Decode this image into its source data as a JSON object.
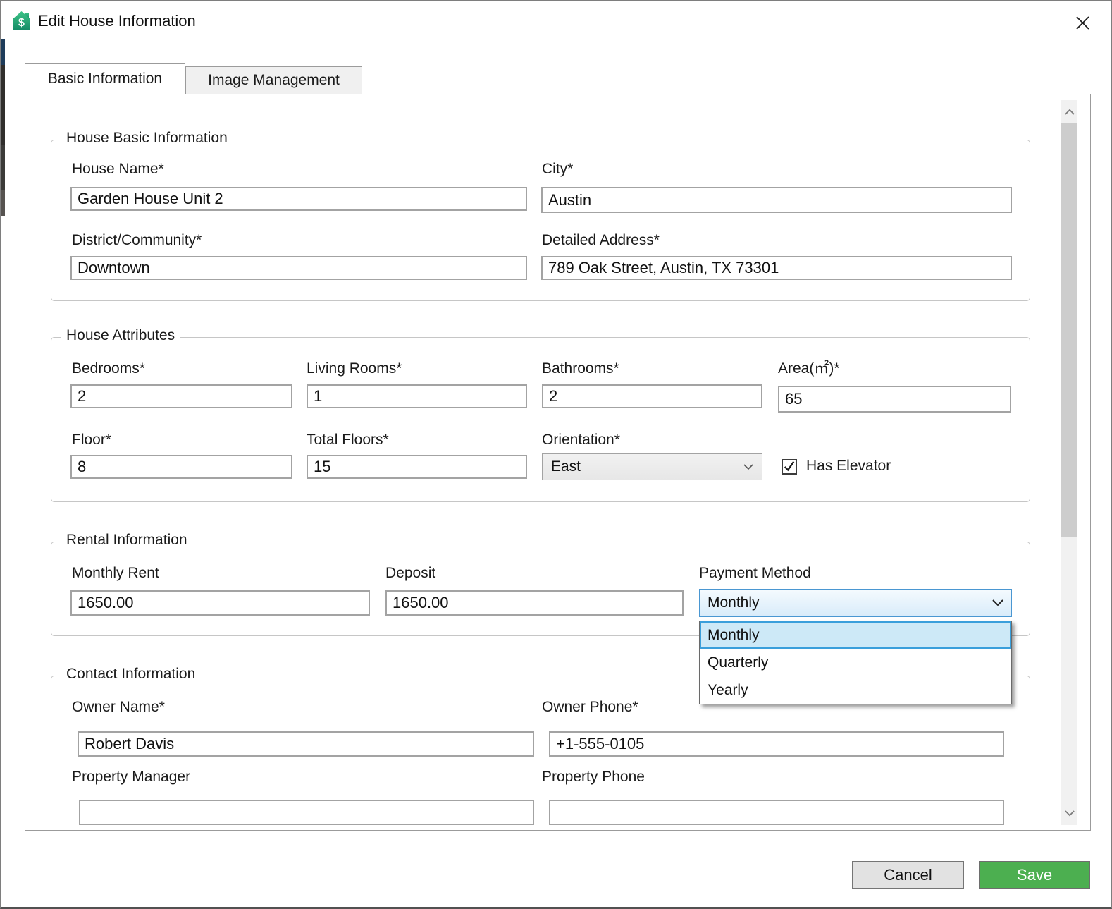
{
  "window": {
    "title": "Edit House Information"
  },
  "tabs": {
    "basic": "Basic Information",
    "image": "Image Management"
  },
  "basic": {
    "legend": "House Basic Information",
    "house_name_label": "House Name*",
    "house_name_value": "Garden House Unit 2",
    "city_label": "City*",
    "city_value": "Austin",
    "district_label": "District/Community*",
    "district_value": "Downtown",
    "address_label": "Detailed Address*",
    "address_value": "789 Oak Street, Austin, TX 73301"
  },
  "attributes": {
    "legend": "House Attributes",
    "bedrooms_label": "Bedrooms*",
    "bedrooms_value": "2",
    "living_rooms_label": "Living Rooms*",
    "living_rooms_value": "1",
    "bathrooms_label": "Bathrooms*",
    "bathrooms_value": "2",
    "area_label": "Area(㎡)*",
    "area_value": "65",
    "floor_label": "Floor*",
    "floor_value": "8",
    "total_floors_label": "Total Floors*",
    "total_floors_value": "15",
    "orientation_label": "Orientation*",
    "orientation_value": "East",
    "has_elevator_label": "Has Elevator",
    "has_elevator_checked": true
  },
  "rental": {
    "legend": "Rental Information",
    "monthly_rent_label": "Monthly Rent",
    "monthly_rent_value": "1650.00",
    "deposit_label": "Deposit",
    "deposit_value": "1650.00",
    "payment_label": "Payment Method",
    "payment_value": "Monthly",
    "payment_options": [
      "Monthly",
      "Quarterly",
      "Yearly"
    ],
    "payment_selected": "Monthly"
  },
  "contact": {
    "legend": "Contact Information",
    "owner_name_label": "Owner Name*",
    "owner_name_value": "Robert Davis",
    "owner_phone_label": "Owner Phone*",
    "owner_phone_value": "+1-555-0105",
    "property_manager_label": "Property Manager",
    "property_manager_value": "",
    "property_phone_label": "Property Phone",
    "property_phone_value": ""
  },
  "actions": {
    "cancel": "Cancel",
    "save": "Save"
  },
  "colors": {
    "accent_green": "#4caf50",
    "combo_border": "#4a97d2",
    "combo_bg": "#ddeefb",
    "highlight_bg": "#cde9f7",
    "highlight_border": "#3a9fdb"
  }
}
